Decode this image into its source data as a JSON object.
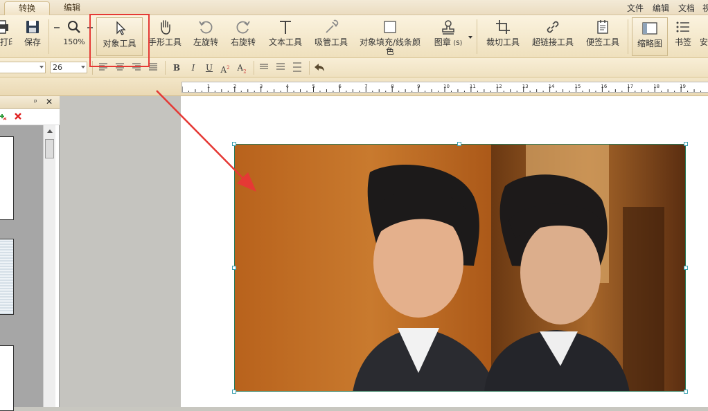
{
  "tabs": [
    {
      "label": "转换",
      "active": true
    },
    {
      "label": "编辑",
      "active": false
    }
  ],
  "menu": {
    "file": "文件",
    "edit": "编辑",
    "doc": "文档",
    "view": "视"
  },
  "toolbar": {
    "print": "打印",
    "save": "保存",
    "zoom": "150%",
    "object_tool": "对象工具",
    "hand_tool": "手形工具",
    "rotate_left": "左旋转",
    "rotate_right": "右旋转",
    "text_tool": "文本工具",
    "eyedropper": "吸管工具",
    "fill_color": "对象填充/线条颜色",
    "stamp": "图章",
    "stamp_shortcut": "(S)",
    "crop_tool": "裁切工具",
    "link_tool": "超链接工具",
    "note_tool": "便签工具",
    "thumbnails": "缩略图",
    "bookmarks": "书签",
    "security": "安"
  },
  "format": {
    "font_size": "26",
    "bold": "B",
    "italic": "I",
    "underline": "U",
    "superscript": "A",
    "sup_mark": "2",
    "subscript": "A",
    "sub_mark": "2"
  },
  "ruler": {
    "labels": [
      "1",
      "2",
      "3",
      "4",
      "5",
      "6",
      "7",
      "8",
      "9",
      "10",
      "11",
      "12",
      "13",
      "14",
      "15",
      "16",
      "17",
      "18",
      "19"
    ]
  },
  "panel": {
    "pin": "ᵖ",
    "close": "✕"
  },
  "colors": {
    "highlight": "#e53935",
    "arrow": "#e53935",
    "toolbar_bg": "#f5e9cc",
    "selection": "#3aa0b0"
  }
}
